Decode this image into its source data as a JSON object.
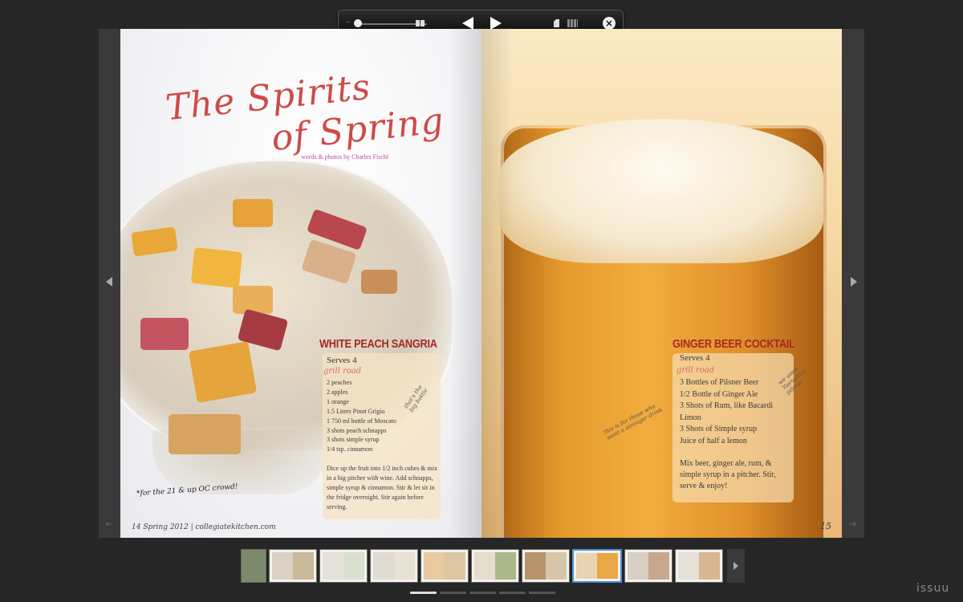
{
  "toolbar": {
    "zoom_min_label": "–",
    "prev_label": "",
    "next_label": "",
    "close_label": "×"
  },
  "left_page": {
    "title_line1": "The Spirits",
    "title_line2": "of Spring",
    "byline": "words & photos by Charles Fischl",
    "recipe": {
      "title": "WHITE PEACH SANGRIA",
      "serves": "Serves 4",
      "subhead": "grill road",
      "ingredients": [
        "2 peaches",
        "2 apples",
        "1 orange",
        "1.5 Liters Pinot Grigio",
        "1 750 ml bottle of Moscato",
        "3 shots peach schnapps",
        "3 shots simple syrup",
        "1/4 tsp. cinnamon"
      ],
      "note": "that's the big bottle",
      "method": "Dice up the fruit into 1/2 inch cubes & mix in a big pitcher with wine. Add schnapps, simple syrup & cinnamon. Stir & let sit in the fridge overnight. Stir again before serving."
    },
    "footnote": "*for the 21 & up OC crowd!",
    "folio": "14  Spring 2012  |  collegiatekitchen.com"
  },
  "right_page": {
    "recipe": {
      "title": "GINGER BEER COCKTAIL",
      "serves": "Serves 4",
      "subhead": "grill road",
      "ingredients": [
        "3 Bottles of Pilsner Beer",
        "1/2 Bottle of Ginger Ale",
        "3 Shots of Rum, like Bacardi",
        "Limon",
        "3 Shots of Simple syrup",
        "Juice of half a lemon"
      ],
      "method": "Mix beer, ginger ale, rum, & simple syrup in a pitcher. Stir, serve & enjoy!"
    },
    "note_top": "we used Yuengling pilsner",
    "note_side": "this is for those who want a stronger drink",
    "folio": "15"
  },
  "thumbnails": {
    "count": 10,
    "active_index": 7
  },
  "brand": "issuu",
  "colors": {
    "accent_red": "#a52a24",
    "title_red": "#cf4a48",
    "active_thumb": "#4a90d9"
  }
}
